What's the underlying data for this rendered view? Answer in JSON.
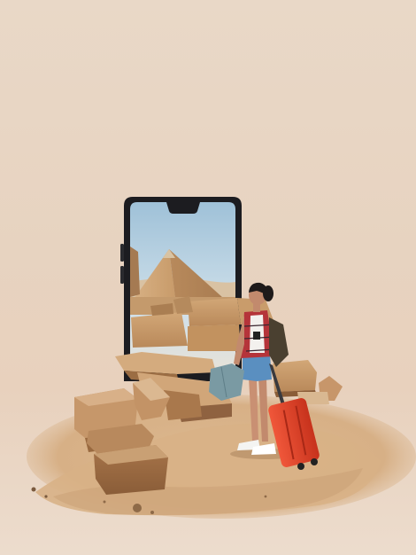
{
  "scene": {
    "type": "photo-composite",
    "palette": {
      "background": "#e8d6c5",
      "sand": "#d9b48a",
      "stone": "#b98657",
      "phone_frame": "#1e1e22",
      "sky": "#b8d3e4",
      "suitcase": "#e0442a"
    }
  }
}
